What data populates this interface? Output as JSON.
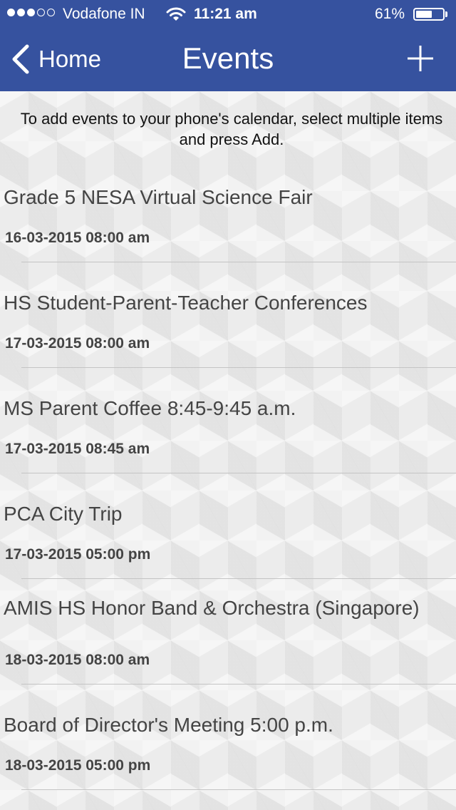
{
  "status_bar": {
    "carrier": "Vodafone IN",
    "time": "11:21 am",
    "battery": "61%",
    "battery_level": 0.61,
    "signal_bars_filled": 3,
    "signal_bars_total": 5
  },
  "nav": {
    "back_label": "Home",
    "title": "Events",
    "add_icon": "plus-icon"
  },
  "instructions": "To add events to your phone's calendar, select multiple items and press Add.",
  "events": [
    {
      "title": "Grade 5 NESA Virtual Science Fair",
      "date": "16-03-2015 08:00 am"
    },
    {
      "title": "HS Student-Parent-Teacher Conferences",
      "date": "17-03-2015 08:00 am"
    },
    {
      "title": "MS Parent Coffee 8:45-9:45 a.m.",
      "date": "17-03-2015 08:45 am"
    },
    {
      "title": "PCA City Trip",
      "date": "17-03-2015 05:00 pm"
    },
    {
      "title": "AMIS HS Honor Band & Orchestra (Singapore)",
      "date": "18-03-2015 08:00 am"
    },
    {
      "title": "Board of Director's Meeting 5:00 p.m.",
      "date": "18-03-2015 05:00 pm"
    }
  ],
  "colors": {
    "header_bg": "#36529f",
    "page_bg": "#ececec",
    "text": "#444444"
  }
}
